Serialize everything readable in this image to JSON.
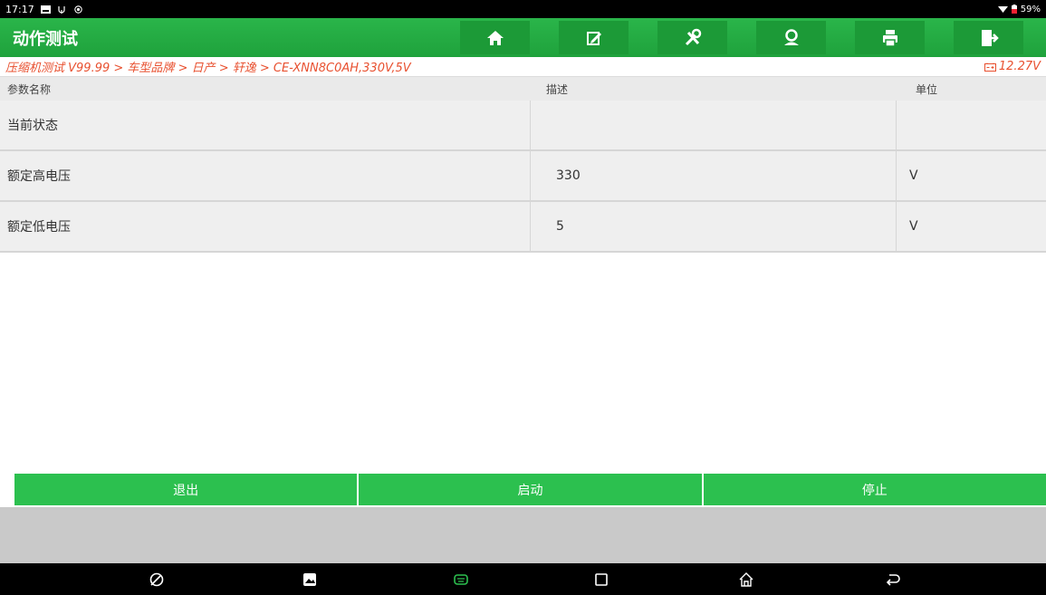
{
  "status": {
    "time": "17:17",
    "battery": "59%"
  },
  "header": {
    "title": "动作测试"
  },
  "toolbar": [
    "home-icon",
    "edit-icon",
    "tools-icon",
    "user-icon",
    "print-icon",
    "exit-icon"
  ],
  "breadcrumb": {
    "path": "压缩机测试 V99.99 > 车型品牌 > 日产 > 轩逸 > CE-XNN8C0AH,330V,5V",
    "voltage": "12.27V"
  },
  "table": {
    "headers": [
      "参数名称",
      "描述",
      "单位"
    ],
    "rows": [
      [
        "当前状态",
        "",
        ""
      ],
      [
        "额定高电压",
        "330",
        "V"
      ],
      [
        "额定低电压",
        "5",
        "V"
      ]
    ]
  },
  "actions": [
    "退出",
    "启动",
    "停止"
  ],
  "colors": {
    "accent": "#2ab54a",
    "button": "#2cc04f",
    "breadcrumb": "#e8502f"
  }
}
